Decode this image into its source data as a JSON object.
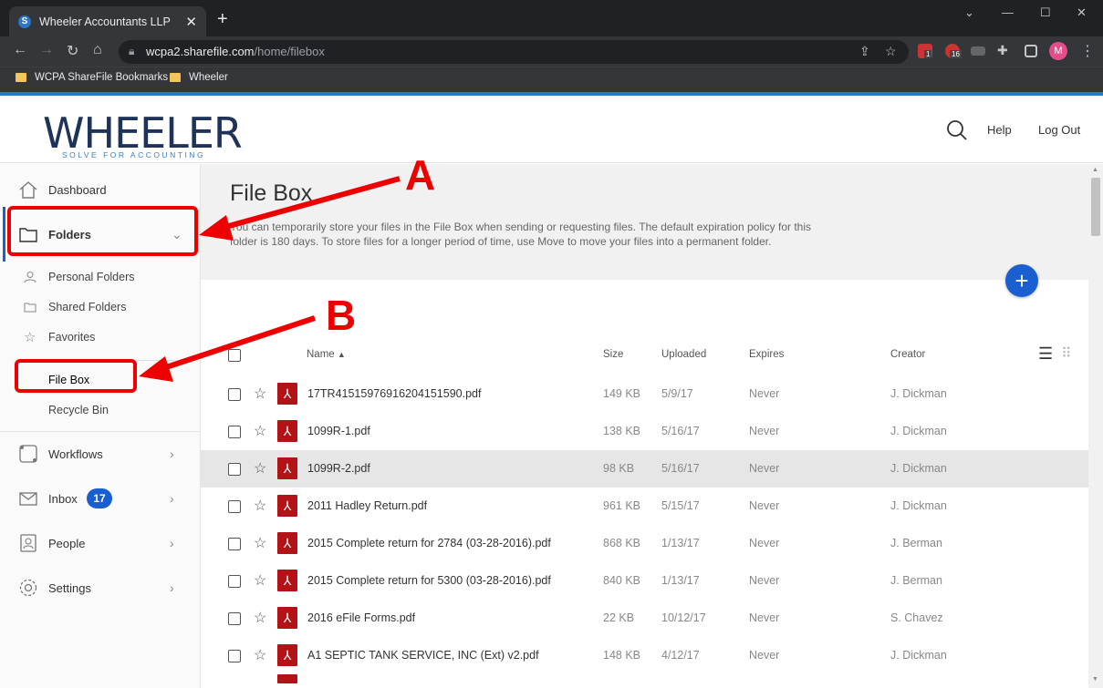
{
  "browser": {
    "tab_title": "Wheeler Accountants LLP",
    "url_host": "wcpa2.sharefile.com",
    "url_path": "/home/filebox",
    "profile_initial": "M",
    "bookmarks": [
      "WCPA ShareFile Bookmarks",
      "Wheeler"
    ],
    "ext_badges": [
      "1",
      "16"
    ]
  },
  "header": {
    "logo_text": "WHEELER",
    "logo_tagline": "SOLVE FOR ACCOUNTING",
    "help": "Help",
    "logout": "Log Out"
  },
  "sidebar": {
    "dashboard": "Dashboard",
    "folders": "Folders",
    "sub": [
      "Personal Folders",
      "Shared Folders",
      "Favorites",
      "File Box",
      "Recycle Bin"
    ],
    "workflows": "Workflows",
    "inbox": "Inbox",
    "inbox_count": "17",
    "people": "People",
    "settings": "Settings"
  },
  "main": {
    "title": "File Box",
    "description": "You can temporarily store your files in the File Box when sending or requesting files. The default expiration policy for this folder is 180 days. To store files for a longer period of time, use Move to move your files into a permanent folder.",
    "columns": {
      "name": "Name",
      "size": "Size",
      "uploaded": "Uploaded",
      "expires": "Expires",
      "creator": "Creator"
    },
    "files": [
      {
        "name": "17TR41515976916204151590.pdf",
        "size": "149 KB",
        "uploaded": "5/9/17",
        "expires": "Never",
        "creator": "J. Dickman"
      },
      {
        "name": "1099R-1.pdf",
        "size": "138 KB",
        "uploaded": "5/16/17",
        "expires": "Never",
        "creator": "J. Dickman"
      },
      {
        "name": "1099R-2.pdf",
        "size": "98 KB",
        "uploaded": "5/16/17",
        "expires": "Never",
        "creator": "J. Dickman"
      },
      {
        "name": "2011 Hadley Return.pdf",
        "size": "961 KB",
        "uploaded": "5/15/17",
        "expires": "Never",
        "creator": "J. Dickman"
      },
      {
        "name": "2015 Complete return for 2784 (03-28-2016).pdf",
        "size": "868 KB",
        "uploaded": "1/13/17",
        "expires": "Never",
        "creator": "J. Berman"
      },
      {
        "name": "2015 Complete return for 5300 (03-28-2016).pdf",
        "size": "840 KB",
        "uploaded": "1/13/17",
        "expires": "Never",
        "creator": "J. Berman"
      },
      {
        "name": "2016 eFile Forms.pdf",
        "size": "22 KB",
        "uploaded": "10/12/17",
        "expires": "Never",
        "creator": "S. Chavez"
      },
      {
        "name": "A1 SEPTIC TANK SERVICE, INC (Ext) v2.pdf",
        "size": "148 KB",
        "uploaded": "4/12/17",
        "expires": "Never",
        "creator": "J. Dickman"
      }
    ]
  },
  "annotations": {
    "a": "A",
    "b": "B"
  },
  "colors": {
    "accent": "#1a5fd1",
    "annotation": "#e00000",
    "pdf": "#b31217"
  }
}
